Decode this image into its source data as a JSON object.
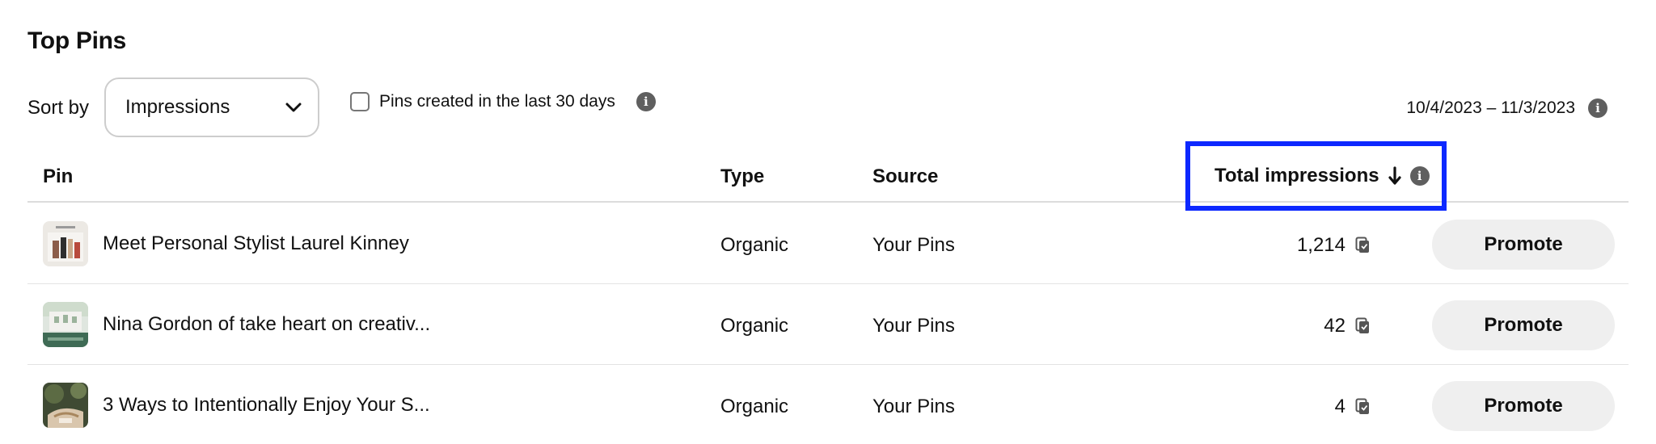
{
  "page": {
    "title": "Top Pins"
  },
  "sort": {
    "label": "Sort by",
    "selected": "Impressions"
  },
  "filter": {
    "label": "Pins created in the last 30 days",
    "checked": false
  },
  "date_range": {
    "text": "10/4/2023 – 11/3/2023"
  },
  "table": {
    "headers": {
      "pin": "Pin",
      "type": "Type",
      "source": "Source",
      "total": "Total impressions"
    },
    "rows": [
      {
        "title": "Meet Personal Stylist Laurel Kinney",
        "type": "Organic",
        "source": "Your Pins",
        "count": "1,214",
        "action": "Promote"
      },
      {
        "title": "Nina Gordon of take heart on creativ...",
        "type": "Organic",
        "source": "Your Pins",
        "count": "42",
        "action": "Promote"
      },
      {
        "title": "3 Ways to Intentionally Enjoy Your S...",
        "type": "Organic",
        "source": "Your Pins",
        "count": "4",
        "action": "Promote"
      }
    ]
  },
  "colors": {
    "highlight": "#0d28ff",
    "button_bg": "#efefef"
  },
  "icons": {
    "info": "info-icon",
    "sort_direction": "arrow-down-icon",
    "dropdown": "chevron-down-icon",
    "count_badge": "copy-icon"
  }
}
